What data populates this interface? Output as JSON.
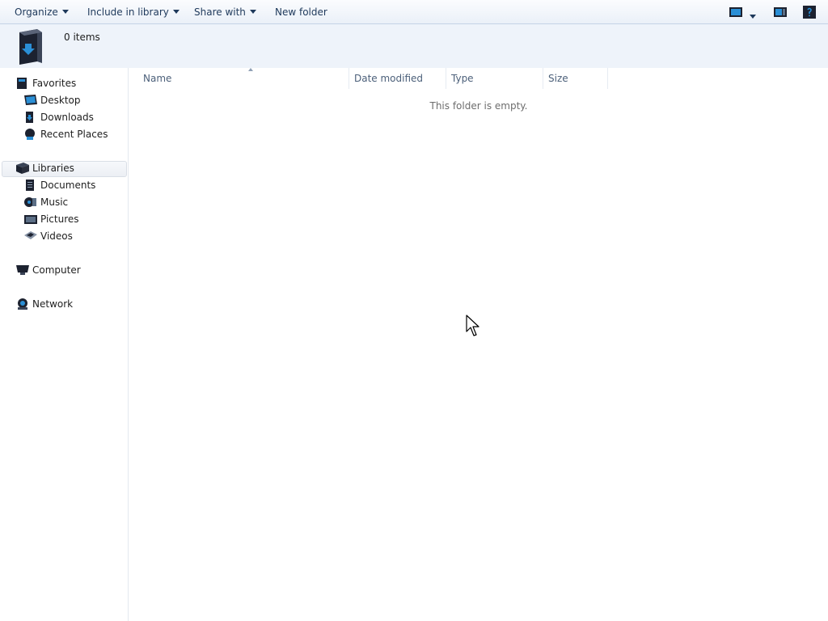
{
  "toolbar": {
    "organize": "Organize",
    "include_in_library": "Include in library",
    "share_with": "Share with",
    "new_folder": "New folder",
    "icons": [
      "change-view-icon",
      "more-options-icon",
      "preview-pane-icon",
      "help-icon"
    ]
  },
  "details": {
    "item_count": "0 items",
    "icon": "downloads-folder-icon"
  },
  "nav": {
    "favorites": "Favorites",
    "desktop": "Desktop",
    "downloads": "Downloads",
    "recent_places": "Recent Places",
    "libraries": "Libraries",
    "documents": "Documents",
    "music": "Music",
    "pictures": "Pictures",
    "videos": "Videos",
    "computer": "Computer",
    "network": "Network"
  },
  "columns": {
    "name": "Name",
    "date_modified": "Date modified",
    "type": "Type",
    "size": "Size"
  },
  "empty_message": "This folder is empty.",
  "colors": {
    "toolbar_text": "#1e395b",
    "header_text": "#4c607a",
    "icon_dark": "#1c2230",
    "icon_blue": "#2a8fd6"
  }
}
